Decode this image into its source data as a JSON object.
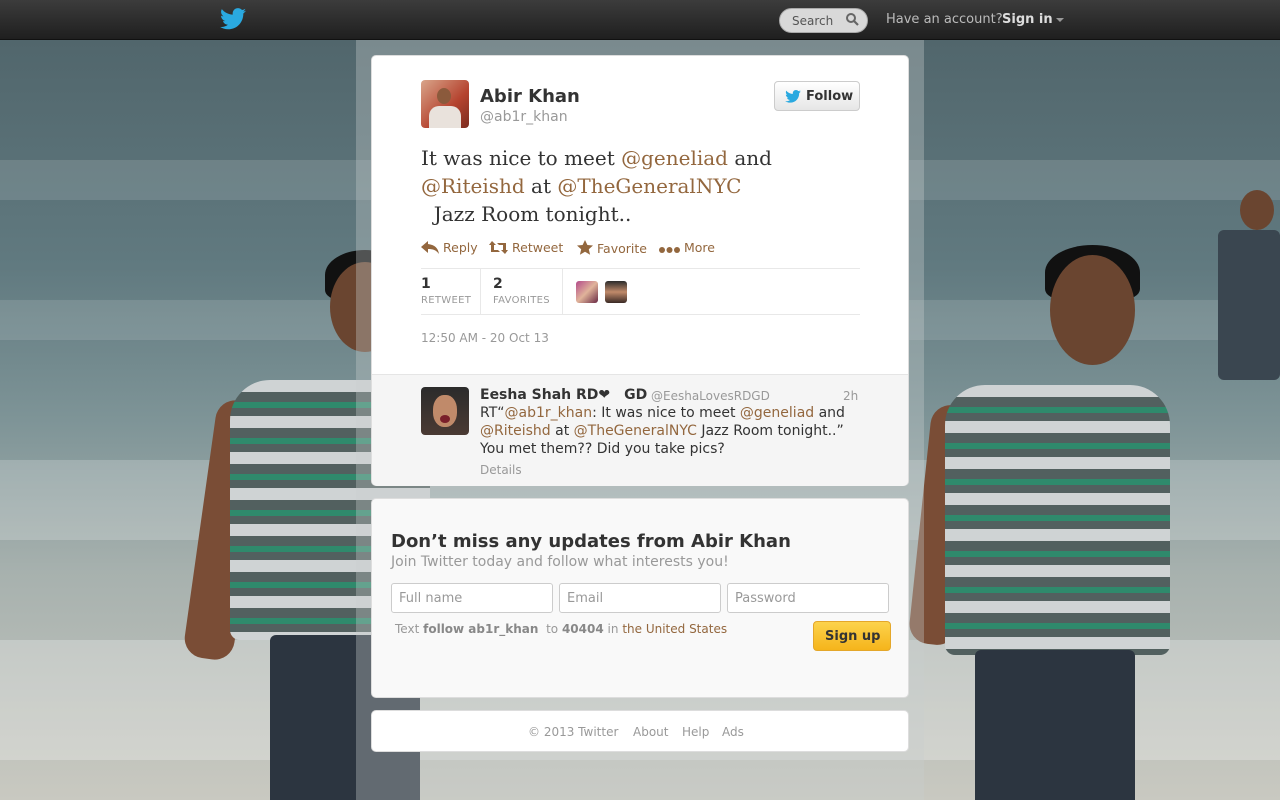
{
  "topbar": {
    "search_label": "Search",
    "have_account": "Have an account?",
    "sign_in": "Sign in"
  },
  "tweet": {
    "author_name": "Abir Khan",
    "author_handle": "@ab1r_khan",
    "follow_label": "Follow",
    "text_segments": [
      {
        "text": "It was nice to meet ",
        "type": "text"
      },
      {
        "text": "@geneliad",
        "type": "mention"
      },
      {
        "text": " and ",
        "type": "text"
      },
      {
        "text": "@Riteishd",
        "type": "mention"
      },
      {
        "text": " at ",
        "type": "text"
      },
      {
        "text": "@TheGeneralNYC",
        "type": "mention"
      },
      {
        "text": "  Jazz Room tonight..",
        "type": "text"
      }
    ],
    "actions": {
      "reply": "Reply",
      "retweet": "Retweet",
      "favorite": "Favorite",
      "more": "More"
    },
    "stats": {
      "retweets_count": "1",
      "retweets_label": "RETWEET",
      "favorites_count": "2",
      "favorites_label": "FAVORITES"
    },
    "timestamp": "12:50 AM - 20 Oct 13"
  },
  "reply": {
    "name": "Eesha Shah RD❤ GD",
    "handle": "@EeshaLovesRDGD",
    "time": "2h",
    "text_segments": [
      {
        "text": "RT“",
        "type": "text"
      },
      {
        "text": "@ab1r_khan",
        "type": "mention"
      },
      {
        "text": ": It was nice to meet ",
        "type": "text"
      },
      {
        "text": "@geneliad",
        "type": "mention"
      },
      {
        "text": " and ",
        "type": "text"
      },
      {
        "text": "@Riteishd",
        "type": "mention"
      },
      {
        "text": " at ",
        "type": "text"
      },
      {
        "text": "@TheGeneralNYC",
        "type": "mention"
      },
      {
        "text": " Jazz Room tonight..” You met them?? Did you take pics?",
        "type": "text"
      }
    ],
    "details": "Details"
  },
  "signup": {
    "title": "Don’t miss any updates from Abir Khan",
    "subtitle": "Join Twitter today and follow what interests you!",
    "fullname_placeholder": "Full name",
    "email_placeholder": "Email",
    "password_placeholder": "Password",
    "sms_text": "Text",
    "sms_command": "follow ab1r_khan",
    "sms_to": "to",
    "sms_number": "40404",
    "sms_in": "in",
    "sms_country": "the United States",
    "button": "Sign up"
  },
  "footer": {
    "copyright": "© 2013 Twitter",
    "about": "About",
    "help": "Help",
    "ads": "Ads"
  },
  "colors": {
    "link": "#93673e",
    "twitter_blue": "#2aa9e0",
    "signup_button": "#f5b41b"
  }
}
